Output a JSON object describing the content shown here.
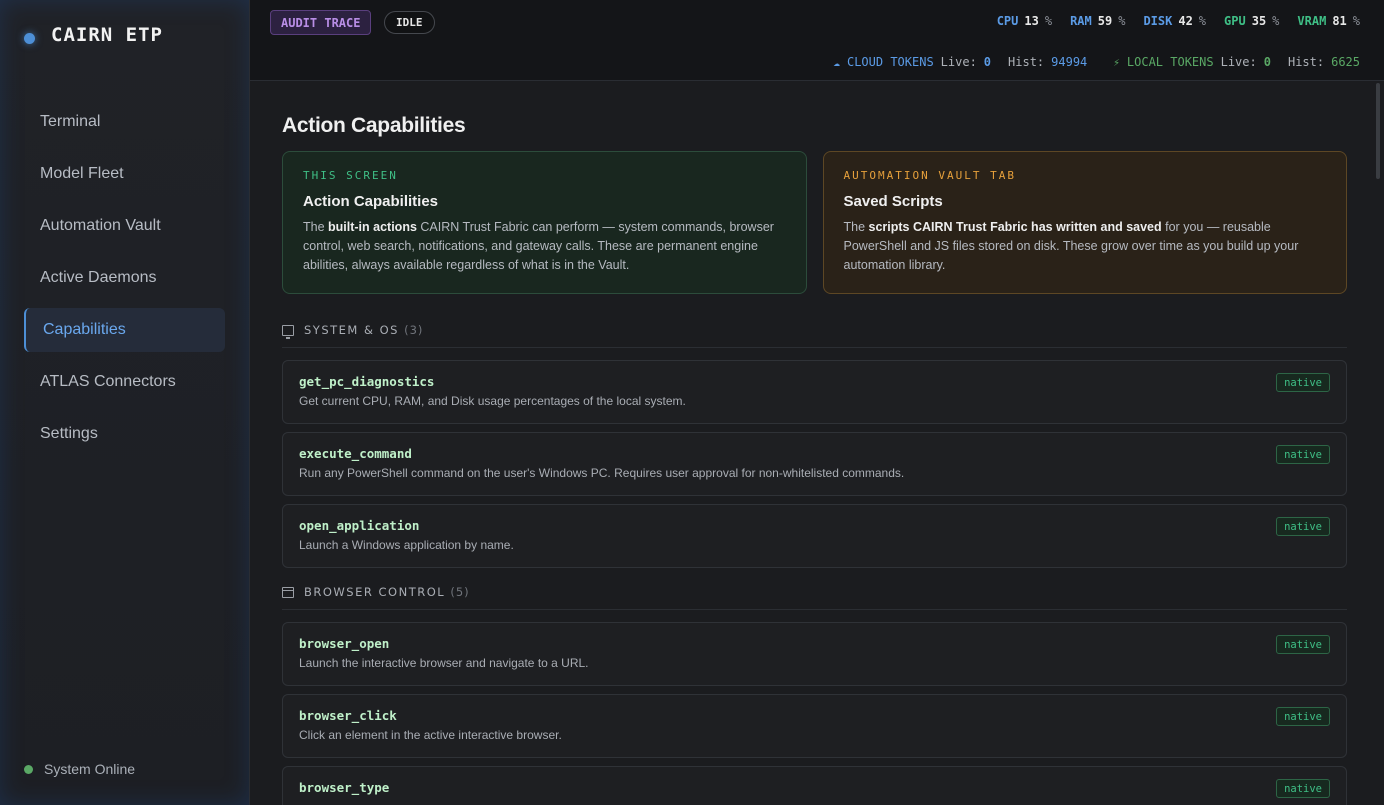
{
  "app": {
    "name": "CAIRN ETP"
  },
  "sidebar": {
    "items": [
      {
        "label": "Terminal"
      },
      {
        "label": "Model Fleet"
      },
      {
        "label": "Automation Vault"
      },
      {
        "label": "Active Daemons"
      },
      {
        "label": "Capabilities",
        "active": true
      },
      {
        "label": "ATLAS Connectors"
      },
      {
        "label": "Settings"
      }
    ],
    "status": "System Online"
  },
  "topbar": {
    "audit_label": "AUDIT TRACE",
    "idle_label": "IDLE",
    "metrics": [
      {
        "label": "CPU",
        "value": "13",
        "unit": "%",
        "color": "#5b9be6"
      },
      {
        "label": "RAM",
        "value": "59",
        "unit": "%",
        "color": "#5b9be6"
      },
      {
        "label": "DISK",
        "value": "42",
        "unit": "%",
        "color": "#5b9be6"
      },
      {
        "label": "GPU",
        "value": "35",
        "unit": "%",
        "color": "#3fbf86"
      },
      {
        "label": "VRAM",
        "value": "81",
        "unit": "%",
        "color": "#3fbf86"
      }
    ],
    "tokens": {
      "cloud": {
        "icon": "cloud-icon",
        "label": "CLOUD TOKENS",
        "live_label": "Live:",
        "live": "0",
        "hist_label": "Hist:",
        "hist": "94994",
        "color": "#5b9be6"
      },
      "local": {
        "icon": "bolt-icon",
        "label": "LOCAL TOKENS",
        "live_label": "Live:",
        "live": "0",
        "hist_label": "Hist:",
        "hist": "6625",
        "color": "#5aa865"
      }
    }
  },
  "main": {
    "title": "Action Capabilities",
    "cards": {
      "this_screen": {
        "kicker": "THIS SCREEN",
        "title": "Action Capabilities",
        "body_pre": "The ",
        "body_bold": "built-in actions",
        "body_post": " CAIRN Trust Fabric can perform — system commands, browser control, web search, notifications, and gateway calls. These are permanent engine abilities, always available regardless of what is in the Vault."
      },
      "vault_tab": {
        "kicker": "AUTOMATION VAULT TAB",
        "title": "Saved Scripts",
        "body_pre": "The ",
        "body_bold": "scripts CAIRN Trust Fabric has written and saved",
        "body_post": " for you — reusable PowerShell and JS files stored on disk. These grow over time as you build up your automation library."
      }
    },
    "sections": {
      "system": {
        "icon": "monitor-icon",
        "title": "SYSTEM & OS",
        "count": "(3)",
        "items": [
          {
            "name": "get_pc_diagnostics",
            "desc": "Get current CPU, RAM, and Disk usage percentages of the local system.",
            "badge": "native"
          },
          {
            "name": "execute_command",
            "desc": "Run any PowerShell command on the user's Windows PC. Requires user approval for non-whitelisted commands.",
            "badge": "native"
          },
          {
            "name": "open_application",
            "desc": "Launch a Windows application by name.",
            "badge": "native"
          }
        ]
      },
      "browser": {
        "icon": "browser-icon",
        "title": "BROWSER CONTROL",
        "count": "(5)",
        "items": [
          {
            "name": "browser_open",
            "desc": "Launch the interactive browser and navigate to a URL.",
            "badge": "native"
          },
          {
            "name": "browser_click",
            "desc": "Click an element in the active interactive browser.",
            "badge": "native"
          },
          {
            "name": "browser_type",
            "desc": "",
            "badge": "native"
          }
        ]
      }
    }
  }
}
